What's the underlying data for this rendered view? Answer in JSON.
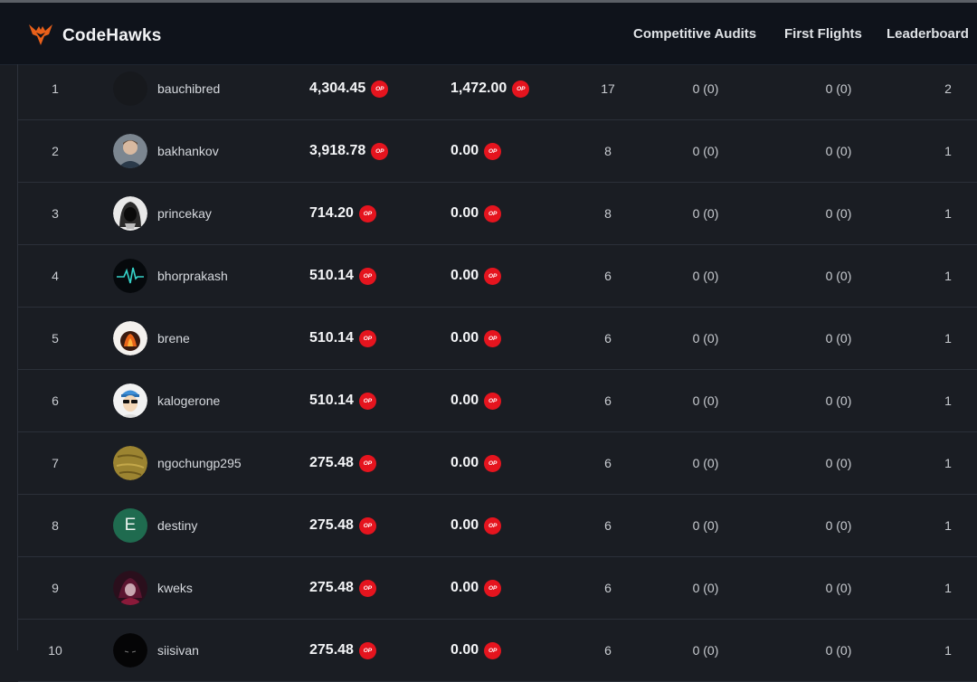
{
  "app": {
    "brand": "CodeHawks",
    "nav": [
      "Competitive Audits",
      "First Flights",
      "Leaderboard"
    ],
    "op_badge": "OP",
    "accent_color": "#e8601a",
    "op_color": "#e5141e"
  },
  "leaderboard": {
    "rows": [
      {
        "rank": "1",
        "username": "bauchibred",
        "avatar": "blank-avatar",
        "amount1": "4,304.45",
        "amount2": "1,472.00",
        "submissions": "17",
        "high": "0 (0)",
        "medium": "0 (0)",
        "firsts": "2"
      },
      {
        "rank": "2",
        "username": "bakhankov",
        "avatar": "photo-avatar",
        "amount1": "3,918.78",
        "amount2": "0.00",
        "submissions": "8",
        "high": "0 (0)",
        "medium": "0 (0)",
        "firsts": "1"
      },
      {
        "rank": "3",
        "username": "princekay",
        "avatar": "hooded-figure-avatar",
        "amount1": "714.20",
        "amount2": "0.00",
        "submissions": "8",
        "high": "0 (0)",
        "medium": "0 (0)",
        "firsts": "1"
      },
      {
        "rank": "4",
        "username": "bhorprakash",
        "avatar": "heartbeat-avatar",
        "amount1": "510.14",
        "amount2": "0.00",
        "submissions": "6",
        "high": "0 (0)",
        "medium": "0 (0)",
        "firsts": "1"
      },
      {
        "rank": "5",
        "username": "brene",
        "avatar": "fire-avatar",
        "amount1": "510.14",
        "amount2": "0.00",
        "submissions": "6",
        "high": "0 (0)",
        "medium": "0 (0)",
        "firsts": "1"
      },
      {
        "rank": "6",
        "username": "kalogerone",
        "avatar": "cartoon-avatar",
        "amount1": "510.14",
        "amount2": "0.00",
        "submissions": "6",
        "high": "0 (0)",
        "medium": "0 (0)",
        "firsts": "1"
      },
      {
        "rank": "7",
        "username": "ngochungp295",
        "avatar": "gold-texture-avatar",
        "amount1": "275.48",
        "amount2": "0.00",
        "submissions": "6",
        "high": "0 (0)",
        "medium": "0 (0)",
        "firsts": "1"
      },
      {
        "rank": "8",
        "username": "destiny",
        "avatar": "letter-avatar",
        "avatar_letter": "E",
        "amount1": "275.48",
        "amount2": "0.00",
        "submissions": "6",
        "high": "0 (0)",
        "medium": "0 (0)",
        "firsts": "1"
      },
      {
        "rank": "9",
        "username": "kweks",
        "avatar": "anime-avatar",
        "amount1": "275.48",
        "amount2": "0.00",
        "submissions": "6",
        "high": "0 (0)",
        "medium": "0 (0)",
        "firsts": "1"
      },
      {
        "rank": "10",
        "username": "siisivan",
        "avatar": "dark-avatar",
        "amount1": "275.48",
        "amount2": "0.00",
        "submissions": "6",
        "high": "0 (0)",
        "medium": "0 (0)",
        "firsts": "1"
      }
    ]
  }
}
